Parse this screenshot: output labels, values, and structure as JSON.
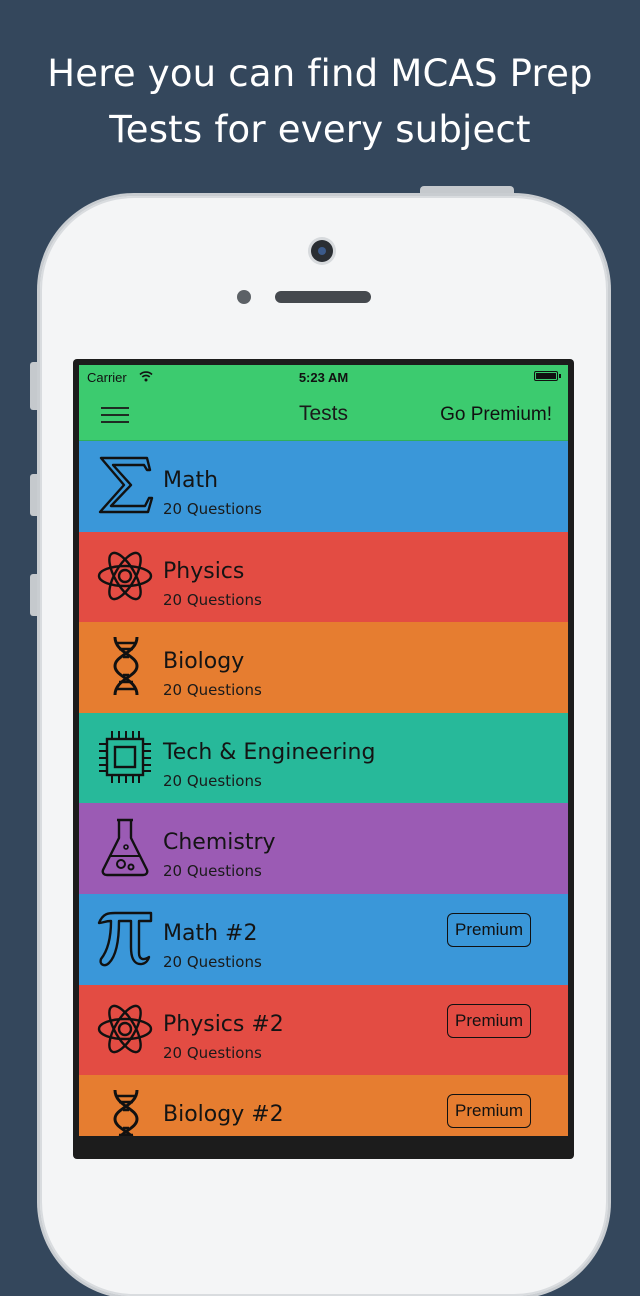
{
  "headline": {
    "line1": "Here you can find MCAS Prep",
    "line2": "Tests for every subject"
  },
  "status_bar": {
    "carrier": "Carrier",
    "time": "5:23 AM"
  },
  "nav": {
    "title": "Tests",
    "premium_link": "Go Premium!"
  },
  "colors": {
    "background": "#34475c",
    "nav_green": "#3ccb6f",
    "blue": "#3a97d9",
    "red": "#e34c43",
    "orange": "#e67d30",
    "teal": "#27b99a",
    "purple": "#9b5bb4"
  },
  "tests": [
    {
      "title": "Math",
      "subtitle": "20 Questions",
      "icon": "sigma-icon",
      "color": "#3a97d9",
      "premium": ""
    },
    {
      "title": "Physics",
      "subtitle": "20 Questions",
      "icon": "atom-icon",
      "color": "#e34c43",
      "premium": ""
    },
    {
      "title": "Biology",
      "subtitle": "20 Questions",
      "icon": "dna-icon",
      "color": "#e67d30",
      "premium": ""
    },
    {
      "title": "Tech & Engineering",
      "subtitle": "20 Questions",
      "icon": "microchip-icon",
      "color": "#27b99a",
      "premium": ""
    },
    {
      "title": "Chemistry",
      "subtitle": "20 Questions",
      "icon": "flask-icon",
      "color": "#9b5bb4",
      "premium": ""
    },
    {
      "title": "Math #2",
      "subtitle": "20 Questions",
      "icon": "pi-icon",
      "color": "#3a97d9",
      "premium": "Premium"
    },
    {
      "title": "Physics #2",
      "subtitle": "20 Questions",
      "icon": "atom-icon",
      "color": "#e34c43",
      "premium": "Premium"
    },
    {
      "title": "Biology #2",
      "subtitle": "",
      "icon": "dna-icon",
      "color": "#e67d30",
      "premium": "Premium"
    }
  ]
}
